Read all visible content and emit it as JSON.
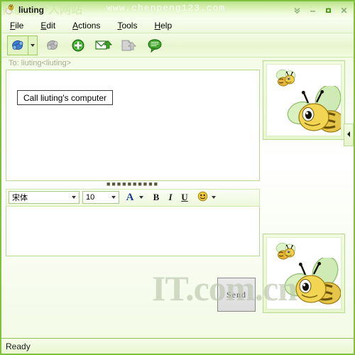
{
  "window": {
    "title": "liuting",
    "icon": "bee-icon",
    "watermark_title": "www.chenpeng123.com",
    "watermark_cjk": "陈鹏的个人网站",
    "watermark_page": "IT.com.cn",
    "controls": [
      {
        "name": "collapse-chevrons-button",
        "glyph": "chevrons-down-icon"
      },
      {
        "name": "minimize-button",
        "glyph": "minimize-icon"
      },
      {
        "name": "maximize-button",
        "glyph": "maximize-icon"
      },
      {
        "name": "close-button",
        "glyph": "close-icon"
      }
    ]
  },
  "menubar": {
    "items": [
      {
        "label": "File",
        "mnemonic": "F"
      },
      {
        "label": "Edit",
        "mnemonic": "E"
      },
      {
        "label": "Actions",
        "mnemonic": "A"
      },
      {
        "label": "Tools",
        "mnemonic": "T"
      },
      {
        "label": "Help",
        "mnemonic": "H"
      }
    ]
  },
  "toolbar": {
    "buttons": [
      {
        "name": "call-computer-button",
        "icon": "phone-blue-icon",
        "enabled": true,
        "pressed": true
      },
      {
        "name": "call-dropdown-button",
        "icon": "chevron-down-icon",
        "enabled": true,
        "pressed": true
      },
      {
        "name": "call-phone-button",
        "icon": "phone-gray-icon",
        "enabled": false,
        "pressed": false
      },
      {
        "name": "add-contact-button",
        "icon": "plus-circle-green-icon",
        "enabled": true,
        "pressed": false
      },
      {
        "name": "send-email-button",
        "icon": "envelope-arrow-icon",
        "enabled": true,
        "pressed": false
      },
      {
        "name": "send-file-button",
        "icon": "file-share-gray-icon",
        "enabled": false,
        "pressed": false
      },
      {
        "name": "chat-button",
        "icon": "speech-bubble-green-icon",
        "enabled": true,
        "pressed": false
      }
    ]
  },
  "tooltip": {
    "text": "Call liuting's computer",
    "visible": true
  },
  "conversation": {
    "to_line": "To: liuting<liuting>",
    "history_text": ""
  },
  "splitter": {
    "dots": "■■■■■■■■■■"
  },
  "format_bar": {
    "font": {
      "label": "font-name-combo",
      "value": "宋体",
      "placeholder": "Font"
    },
    "size": {
      "label": "font-size-combo",
      "value": "10",
      "placeholder": "Size"
    },
    "buttons": [
      {
        "name": "font-color-button",
        "label": "A",
        "icon": "font-color-icon"
      },
      {
        "name": "font-color-dropdown",
        "label": "",
        "icon": "chevron-down-icon"
      },
      {
        "name": "bold-button",
        "label": "B",
        "icon": "bold-icon"
      },
      {
        "name": "italic-button",
        "label": "I",
        "icon": "italic-icon"
      },
      {
        "name": "underline-button",
        "label": "U",
        "icon": "underline-icon"
      },
      {
        "name": "emoticon-button",
        "label": "",
        "icon": "smiley-icon"
      },
      {
        "name": "emoticon-dropdown",
        "label": "",
        "icon": "chevron-down-icon"
      }
    ]
  },
  "compose": {
    "value": "",
    "placeholder": "",
    "send_label": "Send"
  },
  "right_panel": {
    "top_avatar_name": "bee-avatar-top",
    "bottom_avatar_name": "bee-avatar-bottom",
    "collapse_label": "collapse-panel-arrow"
  },
  "statusbar": {
    "text": "Ready"
  },
  "colors": {
    "accent_green": "#7fc13c",
    "titlebar_green": "#b9e48a",
    "panel_bg": "#eef8dd",
    "text": "#1a1a1a",
    "watermark": "#b9c4ab"
  }
}
